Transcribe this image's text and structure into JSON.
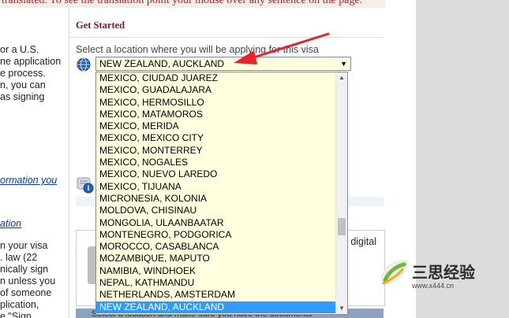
{
  "banner": {
    "text": "translated. To see the translation point your mouse over any sentence on the page."
  },
  "left_column": {
    "lines": [
      "or a U.S.",
      "ne application",
      "e process.",
      "n, you can",
      "as signing"
    ],
    "link1": "ormation you",
    "link2": "ation",
    "lines2": [
      "n your visa",
      ". law (22",
      "nically sign",
      "n unless you",
      "of someone",
      "plication,",
      "e \"Sign"
    ]
  },
  "section": {
    "title": "Get Started",
    "prompt": "Select a location where you will be applying for this visa"
  },
  "location_select": {
    "value": "NEW ZEALAND, AUCKLAND",
    "arrow": "▼"
  },
  "dropdown": {
    "options": [
      "MEXICO, CIUDAD JUAREZ",
      "MEXICO, GUADALAJARA",
      "MEXICO, HERMOSILLO",
      "MEXICO, MATAMOROS",
      "MEXICO, MERIDA",
      "MEXICO, MEXICO CITY",
      "MEXICO, MONTERREY",
      "MEXICO, NOGALES",
      "MEXICO, NUEVO LAREDO",
      "MEXICO, TIJUANA",
      "MICRONESIA, KOLONIA",
      "MOLDOVA, CHISINAU",
      "MONGOLIA, ULAANBAATAR",
      "MONTENEGRO, PODGORICA",
      "MOROCCO, CASABLANCA",
      "MOZAMBIQUE, MAPUTO",
      "NAMIBIA, WINDHOEK",
      "NEPAL, KATHMANDU",
      "NETHERLANDS, AMSTERDAM",
      "NEW ZEALAND, AUCKLAND"
    ],
    "selected_index": 19,
    "scroll_up": "▲",
    "scroll_down": "▼"
  },
  "panel": {
    "right_text": "digital"
  },
  "bottom_bar": {
    "text": "Select a location and make sure you have the documents"
  },
  "watermark": {
    "brand": "三思经验",
    "url": "www.x444.cn"
  },
  "colors": {
    "header_red": "#7a1b1b",
    "select_bg": "#ffffe0",
    "selected_bg": "#3399ff",
    "arrow_red": "#e8232c",
    "link_blue": "#0b3c8a"
  }
}
